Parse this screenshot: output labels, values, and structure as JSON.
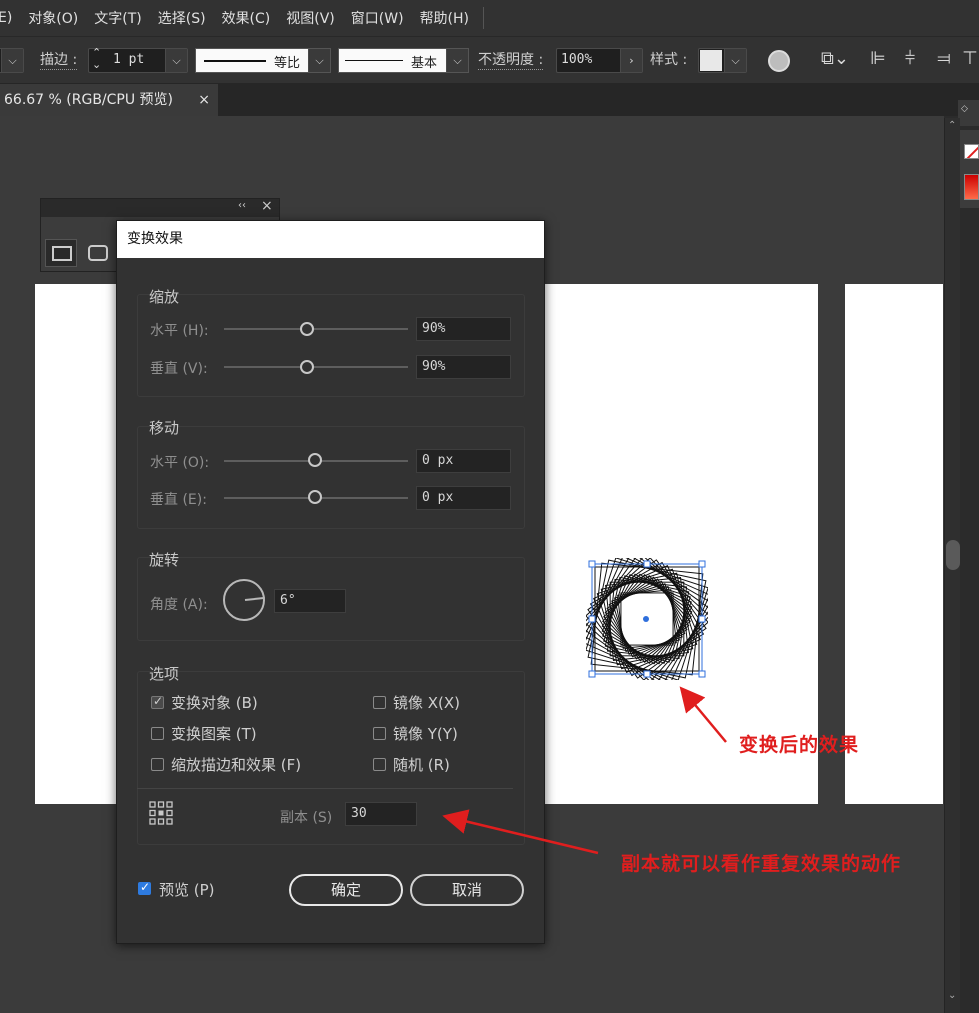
{
  "menubar": {
    "items": [
      "E)",
      "对象(O)",
      "文字(T)",
      "选择(S)",
      "效果(C)",
      "视图(V)",
      "窗口(W)",
      "帮助(H)"
    ]
  },
  "controlbar": {
    "stroke_label": "描边 :",
    "stroke_value": "1 pt",
    "profile_label": "等比",
    "brush_label": "基本",
    "opacity_label": "不透明度 :",
    "opacity_value": "100%",
    "style_label": "样式 :"
  },
  "document_tab": {
    "title": "66.67 % (RGB/CPU 预览)",
    "close": "×"
  },
  "dialog": {
    "title": "变换效果",
    "scale": {
      "title": "缩放",
      "horizontal_label": "水平 (H):",
      "horizontal_value": "90%",
      "horizontal_level": 0.9,
      "vertical_label": "垂直 (V):",
      "vertical_value": "90%",
      "vertical_level": 0.9
    },
    "move": {
      "title": "移动",
      "horizontal_label": "水平 (O):",
      "horizontal_value": "0 px",
      "vertical_label": "垂直 (E):",
      "vertical_value": "0 px"
    },
    "rotate": {
      "title": "旋转",
      "angle_label": "角度 (A):",
      "angle_value": "6°"
    },
    "options": {
      "title": "选项",
      "transform_objects": {
        "label": "变换对象 (B)",
        "checked": true
      },
      "transform_patterns": {
        "label": "变换图案 (T)",
        "checked": false
      },
      "scale_strokes": {
        "label": "缩放描边和效果 (F)",
        "checked": false
      },
      "reflect_x": {
        "label": "镜像 X(X)",
        "checked": false
      },
      "reflect_y": {
        "label": "镜像 Y(Y)",
        "checked": false
      },
      "random": {
        "label": "随机 (R)",
        "checked": false
      },
      "copies_label": "副本 (S)",
      "copies_value": "30"
    },
    "preview": {
      "label": "预览 (P)",
      "checked": true
    },
    "ok_label": "确定",
    "cancel_label": "取消"
  },
  "annotations": {
    "after_effect": "变换后的效果",
    "copies_note": "副本就可以看作重复效果的动作"
  },
  "colors": {
    "annotation": "#e01e1e",
    "selection": "#2f6fdc"
  }
}
